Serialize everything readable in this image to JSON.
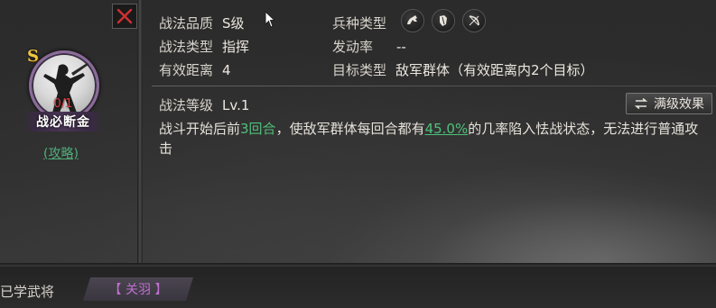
{
  "skill": {
    "grade_badge": "S",
    "count": "0/1",
    "name": "战必断金",
    "strategy_link": "(攻略)"
  },
  "info": {
    "quality_label": "战法品质",
    "quality_value": "S级",
    "troop_label": "兵种类型",
    "troop_icons": [
      "cavalry-icon",
      "shield-icon",
      "bow-icon"
    ],
    "type_label": "战法类型",
    "type_value": "指挥",
    "rate_label": "发动率",
    "rate_value": "--",
    "range_label": "有效距离",
    "range_value": "4",
    "target_label": "目标类型",
    "target_value": "敌军群体（有效距离内2个目标）",
    "level_label": "战法等级",
    "level_value": "Lv.1",
    "max_level_button": "满级效果"
  },
  "description": {
    "part1": "战斗开始后前",
    "rounds": "3回合",
    "part2": "，使敌军群体每回合都有",
    "chance": "45.0%",
    "part3": "的几率陷入怯战状态，无法进行普通攻击"
  },
  "bottom": {
    "learned_label": "已学武将",
    "general": "【 关羽 】"
  },
  "colors": {
    "accent_green": "#4fc07a",
    "grade_gold": "#f0c640",
    "general_purple": "#c070d0",
    "close_red": "#d03030"
  }
}
